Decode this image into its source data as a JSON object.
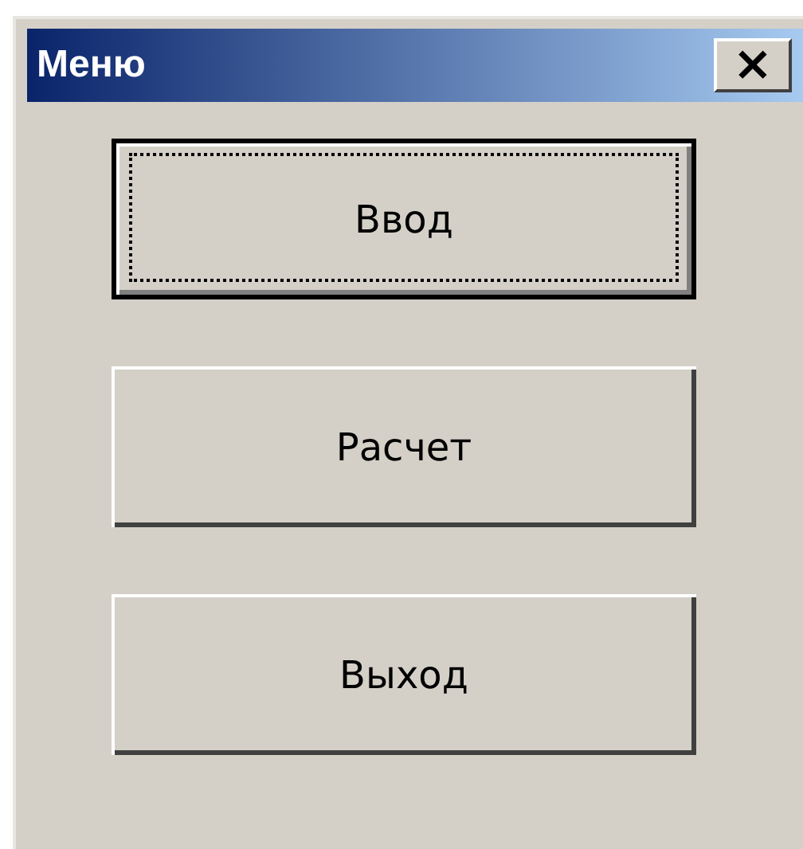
{
  "window": {
    "title": "Меню",
    "close_label": "×"
  },
  "buttons": [
    {
      "label": "Ввод",
      "focused": true
    },
    {
      "label": "Расчет",
      "focused": false
    },
    {
      "label": "Выход",
      "focused": false
    }
  ]
}
